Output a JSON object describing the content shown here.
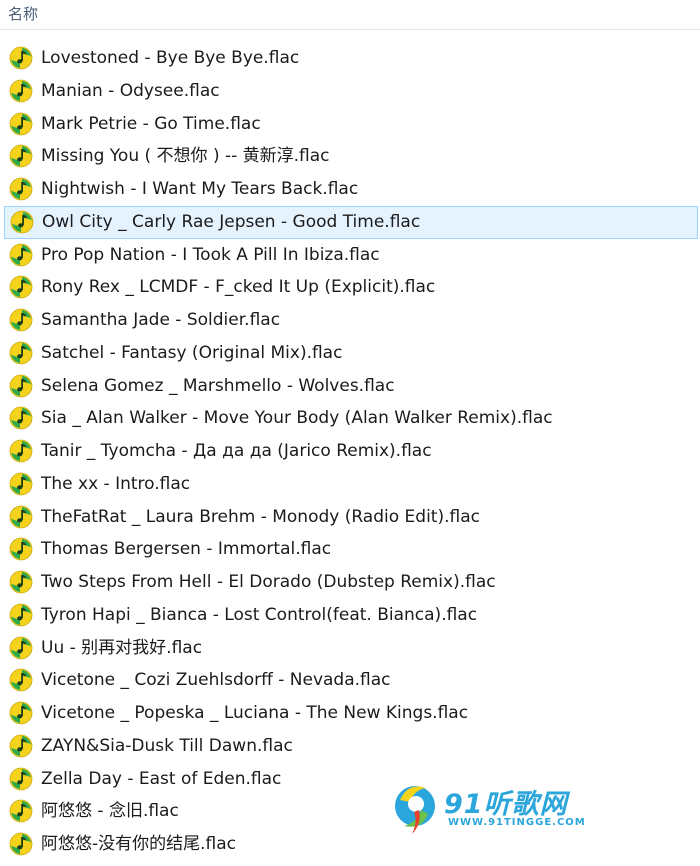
{
  "column_header": {
    "name_label": "名称"
  },
  "files": [
    {
      "name": "Lovestoned - Bye Bye Bye.flac",
      "selected": false
    },
    {
      "name": "Manian - Odysee.flac",
      "selected": false
    },
    {
      "name": "Mark Petrie - Go Time.flac",
      "selected": false
    },
    {
      "name": "Missing You ( 不想你 ) -- 黄新淳.flac",
      "selected": false
    },
    {
      "name": "Nightwish - I Want My Tears Back.flac",
      "selected": false
    },
    {
      "name": "Owl City _ Carly Rae Jepsen - Good Time.flac",
      "selected": true
    },
    {
      "name": "Pro Pop Nation - I Took A Pill In Ibiza.flac",
      "selected": false
    },
    {
      "name": "Rony Rex _ LCMDF - F_cked It Up (Explicit).flac",
      "selected": false
    },
    {
      "name": "Samantha Jade - Soldier.flac",
      "selected": false
    },
    {
      "name": "Satchel - Fantasy (Original Mix).flac",
      "selected": false
    },
    {
      "name": "Selena Gomez _ Marshmello - Wolves.flac",
      "selected": false
    },
    {
      "name": "Sia _ Alan Walker - Move Your Body (Alan Walker Remix).flac",
      "selected": false
    },
    {
      "name": "Tanir _ Tyomcha - Да да да (Jarico Remix).flac",
      "selected": false
    },
    {
      "name": "The xx - Intro.flac",
      "selected": false
    },
    {
      "name": "TheFatRat _ Laura Brehm - Monody (Radio Edit).flac",
      "selected": false
    },
    {
      "name": "Thomas Bergersen - Immortal.flac",
      "selected": false
    },
    {
      "name": "Two Steps From Hell - El Dorado (Dubstep Remix).flac",
      "selected": false
    },
    {
      "name": "Tyron Hapi _ Bianca - Lost Control(feat. Bianca).flac",
      "selected": false
    },
    {
      "name": "Uu - 别再对我好.flac",
      "selected": false
    },
    {
      "name": "Vicetone _ Cozi Zuehlsdorff - Nevada.flac",
      "selected": false
    },
    {
      "name": "Vicetone _ Popeska _ Luciana - The New Kings.flac",
      "selected": false
    },
    {
      "name": "ZAYN&Sia-Dusk Till Dawn.flac",
      "selected": false
    },
    {
      "name": "Zella Day - East of Eden.flac",
      "selected": false
    },
    {
      "name": "阿悠悠 - 念旧.flac",
      "selected": false
    },
    {
      "name": "阿悠悠-没有你的结尾.flac",
      "selected": false
    }
  ],
  "file_icon": "audio-file-icon",
  "colors": {
    "selection_bg": "#e5f3ff",
    "selection_border": "#99d1ff",
    "icon_green": "#2fa84a",
    "icon_yellow": "#f5d31c",
    "header_text": "#4c607a"
  },
  "watermark": {
    "title": "91听歌网",
    "url": "WWW.91TINGGE.COM"
  }
}
